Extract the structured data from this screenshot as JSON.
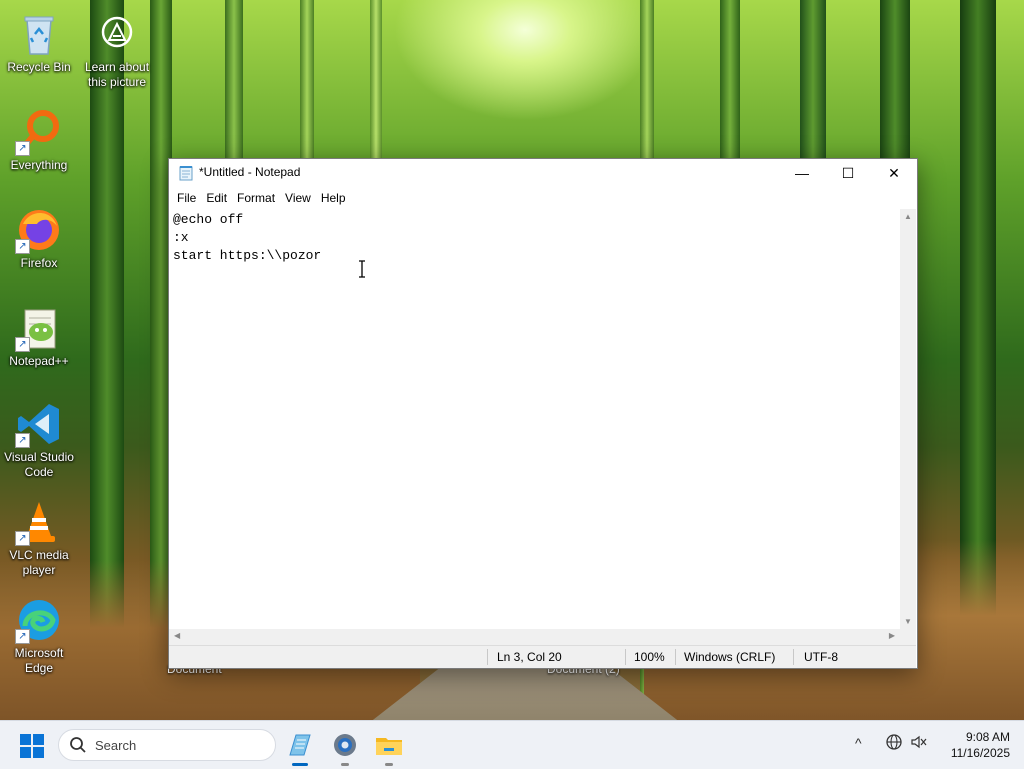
{
  "desktop": {
    "icons": [
      {
        "label": "Recycle Bin",
        "icon": "recycle-bin-icon"
      },
      {
        "label": "Learn about this picture",
        "icon": "camera-info-icon"
      },
      {
        "label": "Everything",
        "icon": "everything-search-icon"
      },
      {
        "label": "Firefox",
        "icon": "firefox-icon"
      },
      {
        "label": "Notepad++",
        "icon": "notepad-plus-plus-icon"
      },
      {
        "label": "Visual Studio Code",
        "icon": "vscode-icon"
      },
      {
        "label": "VLC media player",
        "icon": "vlc-icon"
      },
      {
        "label": "Microsoft Edge",
        "icon": "edge-icon"
      }
    ],
    "background_labels": [
      "Document",
      "Document (2)"
    ]
  },
  "notepad": {
    "title": "*Untitled - Notepad",
    "controls": {
      "minimize": "—",
      "maximize": "☐",
      "close": "✕"
    },
    "menu": [
      "File",
      "Edit",
      "Format",
      "View",
      "Help"
    ],
    "content_lines": [
      "@echo off",
      ":x",
      "start https:\\\\pozor"
    ],
    "status": {
      "position": "Ln 3, Col 20",
      "zoom": "100%",
      "line_ending": "Windows (CRLF)",
      "encoding": "UTF-8"
    }
  },
  "taskbar": {
    "search_placeholder": "Search",
    "apps": [
      "notepad-icon",
      "settings-icon",
      "file-explorer-icon"
    ],
    "tray": {
      "chevron": "^"
    },
    "time": "9:08 AM",
    "date": "11/16/2025"
  },
  "colors": {
    "accent": "#0067c0",
    "taskbar": "#eef1f6",
    "window_bg": "#ffffff"
  }
}
